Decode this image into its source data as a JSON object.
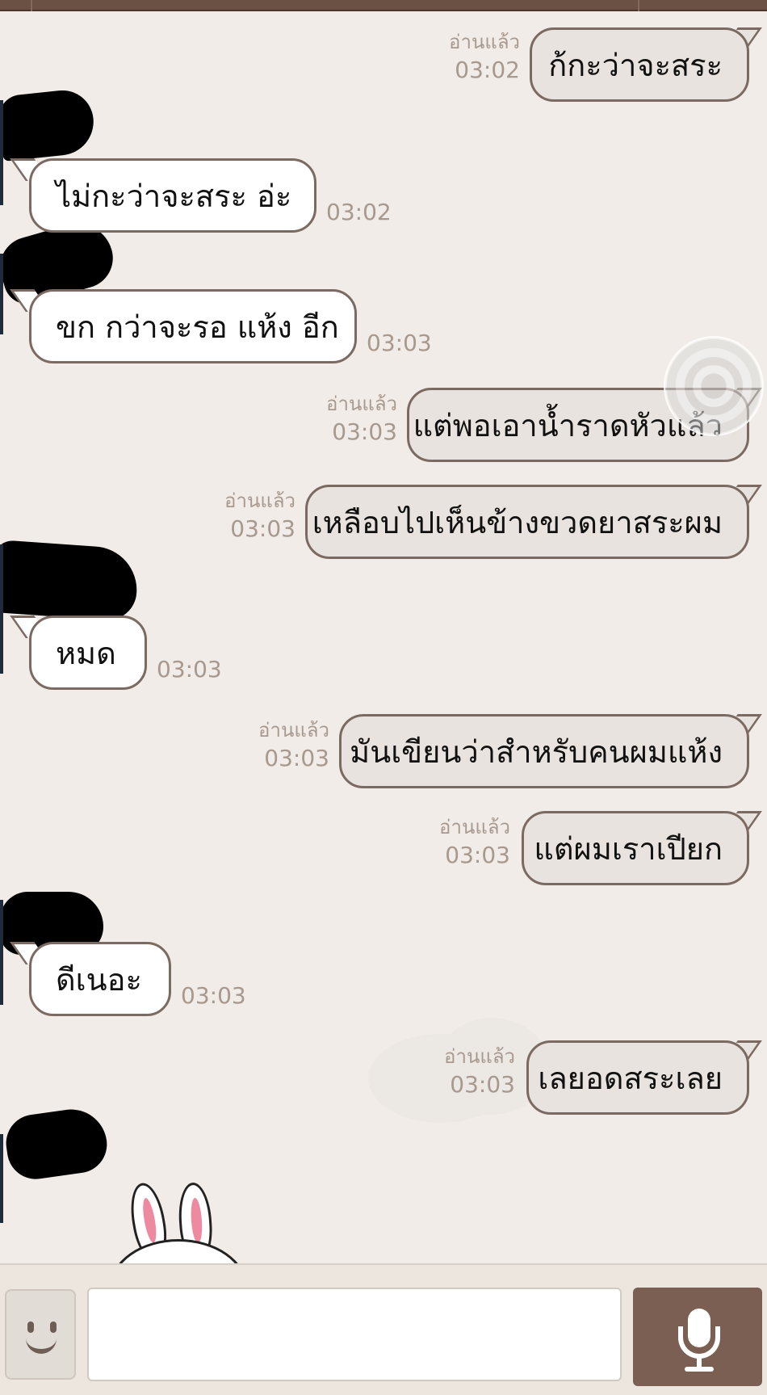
{
  "messages": [
    {
      "side": "out",
      "text": "ก้กะว่าจะสระ",
      "read": "อ่านแล้ว",
      "time": "03:02"
    },
    {
      "side": "in",
      "text": "ไม่กะว่าจะสระ อ่ะ",
      "time": "03:02"
    },
    {
      "side": "in",
      "text": "ขก กว่าจะรอ แห้ง อีก",
      "time": "03:03"
    },
    {
      "side": "out",
      "text": "แต่พอเอาน้ำราดหัวแล้ว",
      "read": "อ่านแล้ว",
      "time": "03:03"
    },
    {
      "side": "out",
      "text": "เหลือบไปเห็นข้างขวดยาสระผม",
      "read": "อ่านแล้ว",
      "time": "03:03"
    },
    {
      "side": "in",
      "text": "หมด",
      "time": "03:03"
    },
    {
      "side": "out",
      "text": "มันเขียนว่าสำหรับคนผมแห้ง",
      "read": "อ่านแล้ว",
      "time": "03:03"
    },
    {
      "side": "out",
      "text": "แต่ผมเราเปียก",
      "read": "อ่านแล้ว",
      "time": "03:03"
    },
    {
      "side": "in",
      "text": "ดีเนอะ",
      "time": "03:03"
    },
    {
      "side": "out",
      "text": "เลยอดสระเลย",
      "read": "อ่านแล้ว",
      "time": "03:03"
    }
  ],
  "input": {
    "value": "",
    "placeholder": ""
  },
  "colors": {
    "background": "#f1ece7",
    "bubble_out": "#e8e3de",
    "bubble_in": "#ffffff",
    "bubble_border": "#7a6a62",
    "meta_text": "#a8998f",
    "accent": "#7a5f52"
  },
  "icons": {
    "emoji_button": "smiley-icon",
    "voice_button": "microphone-icon"
  }
}
